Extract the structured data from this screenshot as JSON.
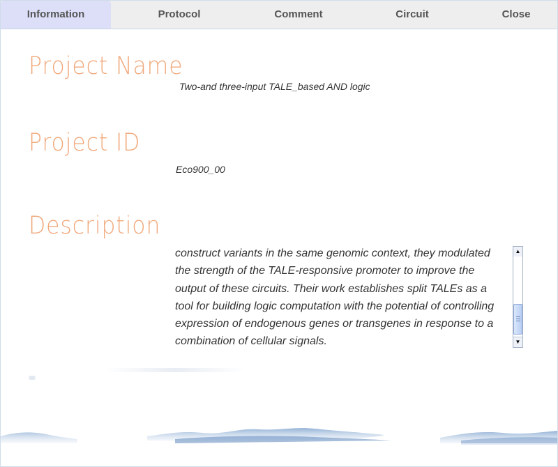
{
  "tabs": [
    {
      "label": "Information"
    },
    {
      "label": "Protocol"
    },
    {
      "label": "Comment"
    },
    {
      "label": "Circuit"
    },
    {
      "label": "Close"
    }
  ],
  "sections": {
    "project_name": {
      "heading": "Project Name",
      "value": "Two-and three-input TALE_based AND logic"
    },
    "project_id": {
      "heading": "Project ID",
      "value": "Eco900_00"
    },
    "description": {
      "heading": "Description",
      "lines": [
        "construct variants in the same genomic context, they modulated",
        "the strength of the TALE-responsive promoter to improve the",
        "output of these circuits. Their work establishes split TALEs as a",
        "tool for building logic computation with the potential of controlling",
        "expression of endogenous genes or transgenes in response to a",
        "combination of cellular signals."
      ]
    }
  },
  "colors": {
    "heading": "#f0a97c",
    "active_tab": "#dddff9",
    "tabbar": "#eeeeee",
    "mountains": "#7fa3cf"
  },
  "scrollbar": {
    "up_icon": "up-arrow-icon",
    "down_icon": "down-arrow-icon"
  }
}
